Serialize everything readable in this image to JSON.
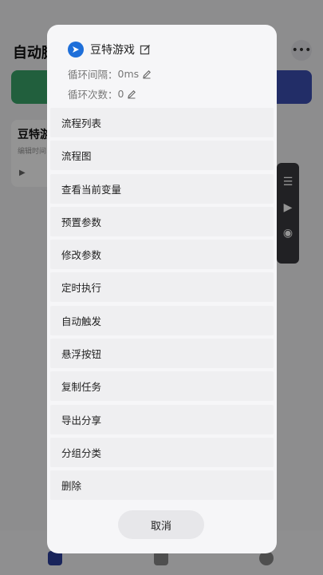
{
  "background": {
    "title": "自动脚",
    "card_title": "豆特游",
    "card_sub": "编辑时间"
  },
  "dialog": {
    "app_name": "豆特游戏",
    "interval_label": "循环间隔：",
    "interval_value": "0ms",
    "count_label": "循环次数：",
    "count_value": "0",
    "menu": [
      {
        "label": "流程列表"
      },
      {
        "label": "流程图"
      },
      {
        "label": "查看当前变量"
      },
      {
        "label": "预置参数"
      },
      {
        "label": "修改参数"
      },
      {
        "label": "定时执行"
      },
      {
        "label": "自动触发"
      },
      {
        "label": "悬浮按钮"
      },
      {
        "label": "复制任务"
      },
      {
        "label": "导出分享"
      },
      {
        "label": "分组分类"
      },
      {
        "label": "删除"
      }
    ],
    "cancel_label": "取消"
  },
  "colors": {
    "accent": "#1e6fd9",
    "dialog_bg": "#f6f6f8",
    "item_bg": "#efeff1"
  }
}
